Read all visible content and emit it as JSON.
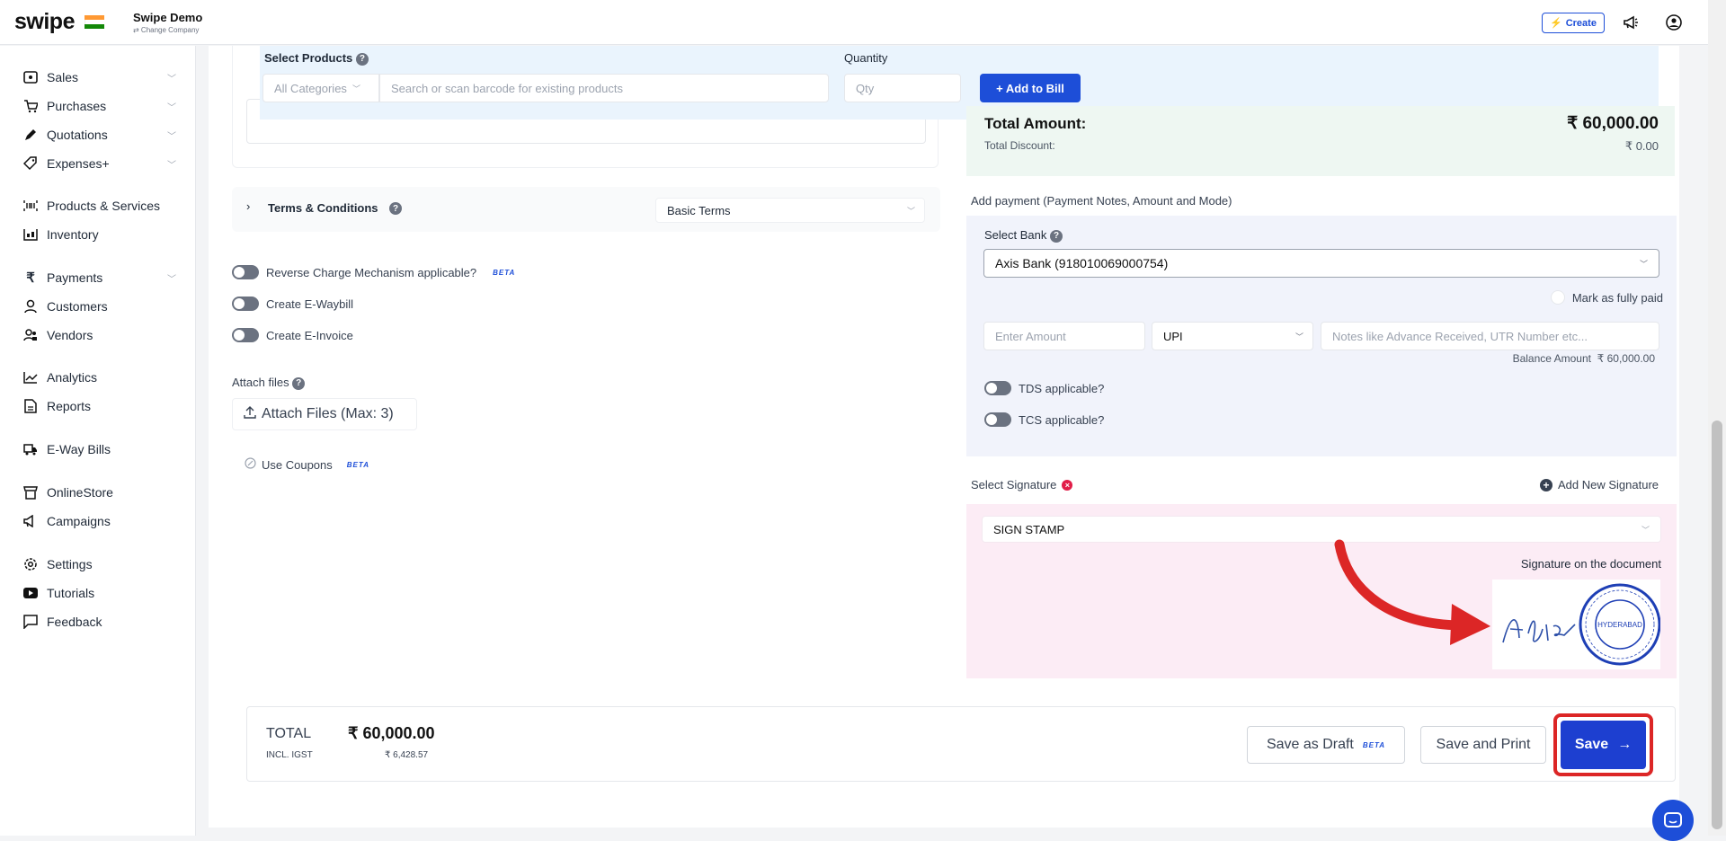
{
  "header": {
    "logo": "swipe",
    "company_name": "Swipe Demo",
    "change_company": "⇄ Change Company",
    "create_label": "Create",
    "icons": [
      "lightning-icon",
      "megaphone-icon",
      "user-avatar-icon"
    ]
  },
  "sidebar": {
    "items": [
      {
        "label": "Sales",
        "icon": "sales-icon",
        "chevron": true
      },
      {
        "label": "Purchases",
        "icon": "cart-icon",
        "chevron": true
      },
      {
        "label": "Quotations",
        "icon": "pen-icon",
        "chevron": true
      },
      {
        "label": "Expenses+",
        "icon": "tag-icon",
        "chevron": true
      },
      {
        "label": "Products & Services",
        "icon": "barcode-icon",
        "chevron": false
      },
      {
        "label": "Inventory",
        "icon": "inventory-icon",
        "chevron": false
      },
      {
        "label": "Payments",
        "icon": "rupee-icon",
        "chevron": true
      },
      {
        "label": "Customers",
        "icon": "user-icon",
        "chevron": false
      },
      {
        "label": "Vendors",
        "icon": "users-icon",
        "chevron": false
      },
      {
        "label": "Analytics",
        "icon": "chart-icon",
        "chevron": false
      },
      {
        "label": "Reports",
        "icon": "report-icon",
        "chevron": false
      },
      {
        "label": "E-Way Bills",
        "icon": "truck-icon",
        "chevron": false
      },
      {
        "label": "OnlineStore",
        "icon": "store-icon",
        "chevron": false
      },
      {
        "label": "Campaigns",
        "icon": "megaphone-icon",
        "chevron": false
      },
      {
        "label": "Settings",
        "icon": "gear-icon",
        "chevron": false
      },
      {
        "label": "Tutorials",
        "icon": "youtube-icon",
        "chevron": false
      },
      {
        "label": "Feedback",
        "icon": "message-icon",
        "chevron": false
      }
    ]
  },
  "products": {
    "title": "Select Products",
    "category_placeholder": "All Categories",
    "search_placeholder": "Search or scan barcode for existing products",
    "quantity_label": "Quantity",
    "qty_placeholder": "Qty",
    "add_to_bill": "+ Add to Bill"
  },
  "terms": {
    "label": "Terms & Conditions",
    "selected": "Basic Terms"
  },
  "options": {
    "reverse_charge": "Reverse Charge Mechanism applicable?",
    "ewaybill": "Create E-Waybill",
    "einvoice": "Create E-Invoice",
    "beta": "BETA",
    "attach_label": "Attach files",
    "attach_button": "Attach Files (Max: 3)",
    "coupons": "Use Coupons"
  },
  "totals": {
    "total_amount_label": "Total Amount:",
    "total_amount_value": "₹ 60,000.00",
    "total_discount_label": "Total Discount:",
    "total_discount_value": "₹ 0.00"
  },
  "payment": {
    "heading": "Add payment (Payment Notes, Amount and Mode)",
    "select_bank_label": "Select Bank",
    "bank_value": "Axis Bank (918010069000754)",
    "mark_paid": "Mark as fully paid",
    "amount_placeholder": "Enter Amount",
    "mode_value": "UPI",
    "notes_placeholder": "Notes like Advance Received, UTR Number etc...",
    "balance_label": "Balance Amount",
    "balance_value": "₹ 60,000.00",
    "tds": "TDS applicable?",
    "tcs": "TCS applicable?"
  },
  "signature": {
    "label": "Select Signature",
    "add_new": "Add New Signature",
    "selected": "SIGN STAMP",
    "on_document": "Signature on the document",
    "stamp_text": "HYDERABAD"
  },
  "footer": {
    "total_label": "TOTAL",
    "total_value": "₹ 60,000.00",
    "tax_label": "INCL. IGST",
    "tax_value": "₹ 6,428.57",
    "save_draft": "Save as Draft",
    "save_print": "Save and Print",
    "save": "Save"
  },
  "colors": {
    "primary": "#1d4ed8",
    "highlight_red": "#dc2626"
  }
}
